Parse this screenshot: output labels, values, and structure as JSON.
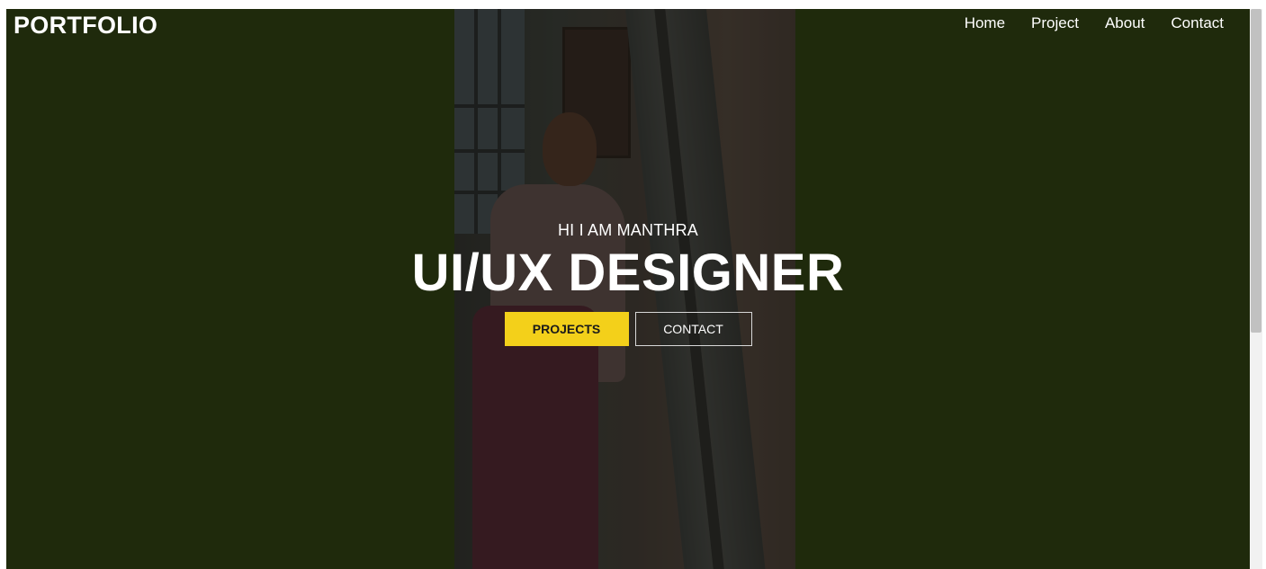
{
  "header": {
    "brand": "PORTFOLIO",
    "nav": [
      {
        "label": "Home"
      },
      {
        "label": "Project"
      },
      {
        "label": "About"
      },
      {
        "label": "Contact"
      }
    ]
  },
  "hero": {
    "greeting": "HI I AM MANTHRA",
    "headline": "UI/UX DESIGNER",
    "buttons": {
      "primary": "PROJECTS",
      "secondary": "CONTACT"
    }
  },
  "colors": {
    "background": "#1f2a0c",
    "accent": "#f3d01a",
    "text": "#ffffff"
  }
}
